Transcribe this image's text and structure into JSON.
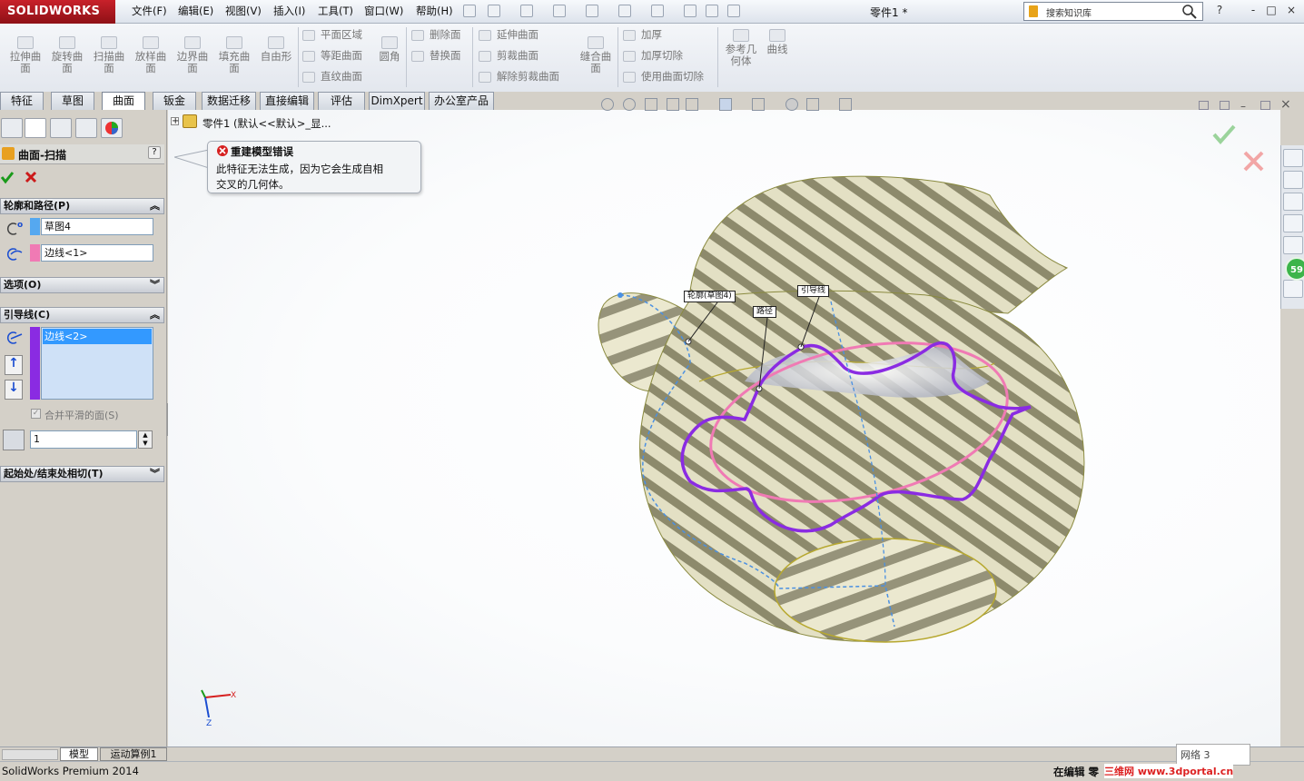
{
  "app": {
    "logo": "SOLIDWORKS",
    "doc_title": "零件1 *"
  },
  "menu": [
    "文件(F)",
    "编辑(E)",
    "视图(V)",
    "插入(I)",
    "工具(T)",
    "窗口(W)",
    "帮助(H)"
  ],
  "search": {
    "placeholder": "搜索知识库"
  },
  "window_buttons": [
    "?",
    "-",
    "□",
    "×"
  ],
  "ribbon": {
    "large": [
      "拉伸曲面",
      "旋转曲面",
      "扫描曲面",
      "放样曲面",
      "边界曲面",
      "填充曲面",
      "自由形"
    ],
    "col1": [
      "平面区域",
      "等距曲面",
      "直纹曲面"
    ],
    "fillet": "圆角",
    "col2": [
      "删除面",
      "替换面"
    ],
    "col3": [
      "延伸曲面",
      "剪裁曲面",
      "解除剪裁曲面"
    ],
    "knit": "缝合曲面",
    "col4": [
      "加厚",
      "加厚切除",
      "使用曲面切除"
    ],
    "refgeom": "参考几何体",
    "curves": "曲线"
  },
  "tabs": [
    "特征",
    "草图",
    "曲面",
    "钣金",
    "数据迁移",
    "直接编辑",
    "评估",
    "DimXpert",
    "办公室产品"
  ],
  "active_tab": "曲面",
  "tree_root": "零件1  (默认<<默认>_显...",
  "property_manager": {
    "title": "曲面-扫描",
    "help": "?",
    "section_profile": "轮廓和路径(P)",
    "profile_value": "草图4",
    "path_value": "边线<1>",
    "section_options": "选项(O)",
    "section_guides": "引导线(C)",
    "guide_item": "边线<2>",
    "merge_faces": "合并平滑的面(S)",
    "spin_value": "1",
    "section_tangency": "起始处/结束处相切(T)"
  },
  "callout": {
    "title": "重建模型错误",
    "body_line1": "此特征无法生成，因为它会生成自相",
    "body_line2": "交叉的几何体。"
  },
  "graphics_labels": {
    "profile": "轮廓(草图4)",
    "path": "路径",
    "guide": "引导线"
  },
  "triad": {
    "x": "X",
    "z": "Z"
  },
  "task_badge": "59",
  "bottom_tabs": [
    "模型",
    "运动算例1"
  ],
  "status": {
    "left": "SolidWorks Premium 2014",
    "mesh": "网络 3",
    "editing": "在编辑 零",
    "watermark": "三维网 www.3dportal.cn"
  },
  "colors": {
    "accent_red": "#c8212a",
    "profile_pink": "#f07ab4",
    "path_purple": "#8a2be2",
    "guide_blue": "#4a90e2",
    "surface": "#c9c7a6"
  }
}
